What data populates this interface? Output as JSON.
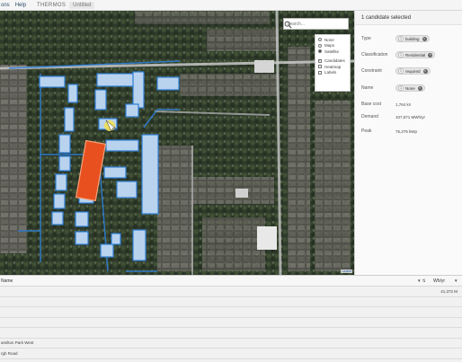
{
  "menubar": {
    "items": [
      "ons",
      "Help"
    ],
    "brand": "THERMOS",
    "document_tab": "Untitled"
  },
  "map": {
    "search": {
      "placeholder": "Search..."
    },
    "layers": {
      "basemap": [
        {
          "label": "None",
          "selected": false
        },
        {
          "label": "Maps",
          "selected": false
        },
        {
          "label": "Satellite",
          "selected": true
        }
      ],
      "overlays": [
        {
          "label": "Candidates",
          "checked": true
        },
        {
          "label": "Heatmap",
          "checked": false
        },
        {
          "label": "Labels",
          "checked": false
        }
      ]
    },
    "attribution": "Leaflet",
    "colors": {
      "candidate_outline": "#2f7fd6",
      "candidate_fill": "#b9d3ee",
      "selected_fill": "#e8501f",
      "road": "#c9c9c9"
    }
  },
  "side_panel": {
    "header": "1 candidate selected",
    "rows": [
      {
        "label": "Type",
        "chip_count": "1",
        "chip_text": "building"
      },
      {
        "label": "Classification",
        "chip_count": "1",
        "chip_text": "Residential"
      },
      {
        "label": "Constraint",
        "chip_count": "1",
        "chip_text": "required"
      },
      {
        "label": "Name",
        "chip_count": "1",
        "chip_text": "None"
      }
    ],
    "values": [
      {
        "label": "Base cost",
        "value": "1,764 k¤"
      },
      {
        "label": "Demand",
        "value": "107,671 MWh/yr"
      },
      {
        "label": "Peak",
        "value": "75,279 kWp"
      }
    ]
  },
  "table": {
    "name_header": "Name",
    "unit_header": "Wh/yr",
    "rows": [
      {
        "name": "",
        "value": "41,372 M"
      },
      {
        "name": "",
        "value": ""
      },
      {
        "name": "",
        "value": ""
      },
      {
        "name": "",
        "value": ""
      },
      {
        "name": "",
        "value": ""
      },
      {
        "name": "amilton Park West",
        "value": ""
      },
      {
        "name": "rgh Road",
        "value": ""
      }
    ]
  }
}
